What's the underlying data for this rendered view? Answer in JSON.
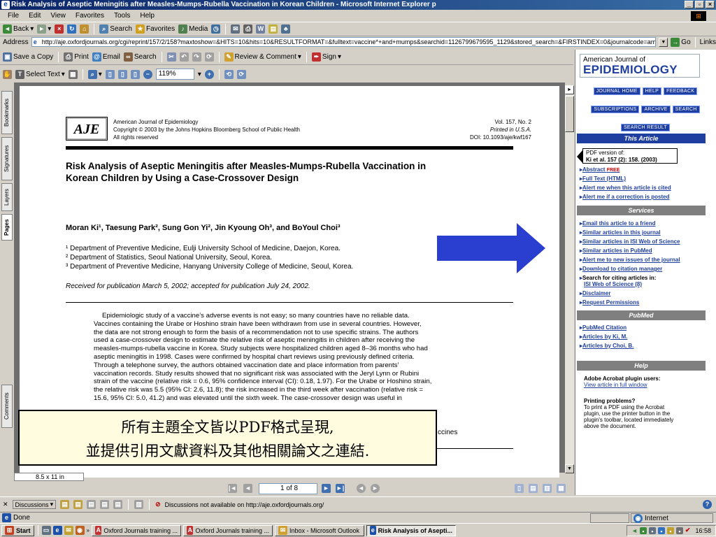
{
  "window": {
    "title": "Risk Analysis of Aseptic Meningitis after Measles-Mumps-Rubella Vaccination in Korean Children - Microsoft Internet Explorer p"
  },
  "menu": [
    "File",
    "Edit",
    "View",
    "Favorites",
    "Tools",
    "Help"
  ],
  "ie_toolbar": {
    "back": "Back",
    "search": "Search",
    "favorites": "Favorites",
    "media": "Media"
  },
  "address": {
    "label": "Address",
    "url": "http://aje.oxfordjournals.org/cgi/reprint/157/2/158?maxtoshow=&HITS=10&hits=10&RESULTFORMAT=&fulltext=vaccine*+and+mumps&searchid=1126799679595_1129&stored_search=&FIRSTINDEX=0&journalcode=amjepic",
    "go": "Go",
    "links": "Links"
  },
  "acrobat_toolbar": {
    "save": "Save a Copy",
    "print": "Print",
    "email": "Email",
    "search": "Search",
    "review": "Review & Comment",
    "sign": "Sign"
  },
  "acrobat_toolbar2": {
    "select_text": "Select Text",
    "zoom": "119%"
  },
  "side_tabs": [
    "Bookmarks",
    "Signatures",
    "Layers",
    "Pages",
    "Comments"
  ],
  "pdf": {
    "journal_name": "American Journal of Epidemiology",
    "copyright": "Copyright © 2003 by the Johns Hopkins Bloomberg School of Public Health",
    "rights": "All rights reserved",
    "vol": "Vol. 157, No. 2",
    "printed": "Printed in U.S.A.",
    "doi": "DOI: 10.1093/aje/kwf167",
    "title_line1": "Risk Analysis of Aseptic Meningitis after Measles-Mumps-Rubella Vaccination in",
    "title_line2": "Korean Children by Using a Case-Crossover Design",
    "authors": "Moran Ki¹, Taesung Park², Sung Gon Yi², Jin Kyoung Oh³, and BoYoul Choi³",
    "affiliations": [
      "¹ Department of Preventive Medicine, Eulji University School of Medicine, Daejon, Korea.",
      "² Department of Statistics, Seoul National University, Seoul, Korea.",
      "³ Department of Preventive Medicine, Hanyang University College of Medicine, Seoul, Korea."
    ],
    "received": "Received for publication March 5, 2002; accepted for publication July 24, 2002.",
    "abstract_lines": [
      "Epidemiologic study of a vaccine’s adverse events is not easy; so many countries have no reliable data.",
      "Vaccines containing the Urabe or Hoshino strain have been withdrawn from use in several countries. However,",
      "the data are not strong enough to form the basis of a recommendation not to use specific strains. The authors",
      "used a case-crossover design to estimate the relative risk of aseptic meningitis in children after receiving the",
      "measles-mumps-rubella vaccine in Korea. Study subjects were hospitalized children aged 8–36 months who had",
      "aseptic meningitis in 1998. Cases were confirmed by hospital chart reviews using previously defined criteria.",
      "Through a telephone survey, the authors obtained vaccination date and place information from parents’",
      "vaccination records. Study results showed that no significant risk was associated with the Jeryl Lynn or Rubini",
      "strain of the vaccine (relative risk = 0.6, 95% confidence interval (CI): 0.18, 1.97). For the Urabe or Hoshino strain,",
      "the relative risk was 5.5 (95% CI: 2.6, 11.8); the risk increased in the third week after vaccination (relative risk =",
      "15.6, 95% CI: 5.0, 41.2) and was elevated until the sixth week. The case-crossover design was useful in"
    ],
    "trailing_word": "ccines"
  },
  "doc_nav": {
    "page_size": "8.5 x 11 in",
    "page_indicator": "1 of 8"
  },
  "overlay": {
    "line1": "所有主題全文皆以PDF格式呈現,",
    "line2": "並提供引用文獻資料及其他相關論文之連結."
  },
  "sidebar": {
    "logo_top": "American Journal of",
    "logo_main": "EPIDEMIOLOGY",
    "btn_row1": [
      "JOURNAL HOME",
      "HELP",
      "FEEDBACK"
    ],
    "btn_row2": [
      "SUBSCRIPTIONS",
      "ARCHIVE",
      "SEARCH"
    ],
    "search_result": "SEARCH RESULT",
    "this_article": "This Article",
    "pdf_version_label": "PDF version of:",
    "pdf_version_ref": "Ki et al. 157 (2): 158. (2003)",
    "abstract_link": "Abstract",
    "free_badge": "FREE",
    "article_links": [
      "Full Text (HTML)",
      "Alert me when this article is cited",
      "Alert me if a correction is posted"
    ],
    "services": "Services",
    "service_links": [
      "Email this article to a friend",
      "Similar articles in this journal",
      "Similar articles in ISI Web of Science",
      "Similar articles in PubMed",
      "Alert me to new issues of the journal",
      "Download to citation manager"
    ],
    "citing_label": "Search for citing articles in:",
    "citing_link": "ISI Web of Science (8)",
    "service_links2": [
      "Disclaimer",
      "Request Permissions"
    ],
    "pubmed": "PubMed",
    "pubmed_links": [
      "PubMed Citation",
      "Articles by Ki, M.",
      "Articles by Choi, B."
    ],
    "help": "Help",
    "help_title1": "Adobe Acrobat plugin users:",
    "help_link1": "View article in full window",
    "help_title2": "Printing problems?",
    "help_text": [
      "To print a PDF using the Acrobat",
      "plugin, use the printer button in the",
      "plugin's toolbar, located immediately",
      "above the document."
    ]
  },
  "discussions": {
    "label": "Discussions",
    "message": "Discussions not available on http://aje.oxfordjournals.org/"
  },
  "status": {
    "done": "Done",
    "zone": "Internet"
  },
  "taskbar": {
    "start": "Start",
    "tasks": [
      "Oxford Journals training ...",
      "Oxford Journals training ...",
      "Inbox - Microsoft Outlook",
      "Risk Analysis of Asepti..."
    ],
    "clock": "16:58"
  }
}
